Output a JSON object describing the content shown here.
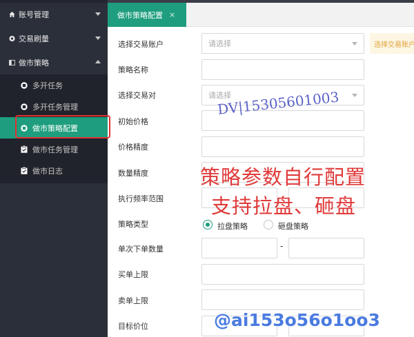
{
  "sidebar": {
    "groups": [
      {
        "label": "账号管理",
        "icon": "home-icon"
      },
      {
        "label": "交易刷量",
        "icon": "circle-icon"
      },
      {
        "label": "做市策略",
        "icon": "panel-icon"
      }
    ],
    "sub_items": [
      {
        "label": "多开任务",
        "icon": "circle-square-icon"
      },
      {
        "label": "多开任务管理",
        "icon": "circle-square-icon"
      },
      {
        "label": "做市策略配置",
        "icon": "circle-square-icon",
        "active": true
      },
      {
        "label": "做市任务管理",
        "icon": "clipboard-icon"
      },
      {
        "label": "做市日志",
        "icon": "clipboard-icon"
      }
    ]
  },
  "tabs": [
    {
      "label": "做市策略配置",
      "close": "×"
    }
  ],
  "form": {
    "account": {
      "label": "选择交易账户",
      "placeholder": "请选择",
      "tip": "选择交易账户"
    },
    "name": {
      "label": "策略名称"
    },
    "pair": {
      "label": "选择交易对",
      "placeholder": "请选择"
    },
    "init_price": {
      "label": "初始价格"
    },
    "price_precision": {
      "label": "价格精度"
    },
    "qty_precision": {
      "label": "数量精度"
    },
    "freq_range": {
      "label": "执行频率范围"
    },
    "strategy_type": {
      "label": "策略类型",
      "options": [
        "拉盘策略",
        "砸盘策略"
      ],
      "selected": "拉盘策略"
    },
    "order_qty": {
      "label": "单次下单数量",
      "sep": "-"
    },
    "buy_limit": {
      "label": "买单上限"
    },
    "sell_limit": {
      "label": "卖单上限"
    },
    "target_price": {
      "label": "目标价位"
    }
  },
  "overlays": {
    "phone_watermark": "DV|15305601003",
    "promo_line1": "策略参数自行配置",
    "promo_line2": "支持拉盘、砸盘",
    "handle": "@ai153o56o1oo3"
  },
  "colors": {
    "accent": "#1e9e7e",
    "sidebar_bg": "#2b2f3a",
    "promo_red": "#e03a3a",
    "highlight_red": "#e03030"
  }
}
